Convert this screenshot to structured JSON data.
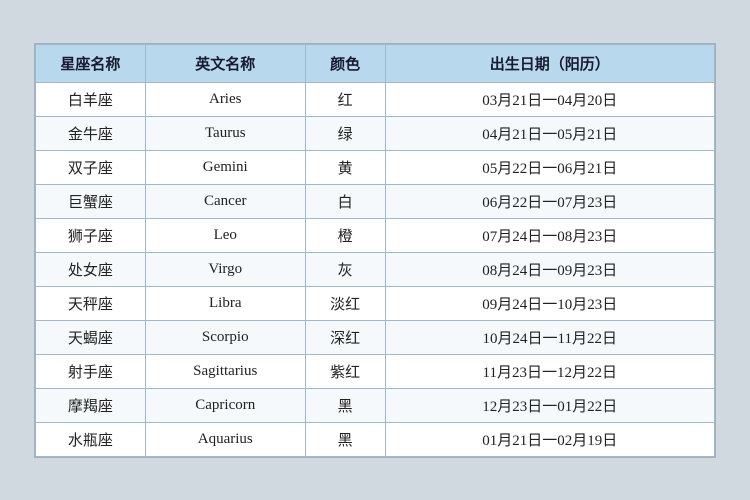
{
  "table": {
    "headers": [
      "星座名称",
      "英文名称",
      "颜色",
      "出生日期（阳历）"
    ],
    "rows": [
      {
        "zh": "白羊座",
        "en": "Aries",
        "color": "红",
        "date": "03月21日一04月20日"
      },
      {
        "zh": "金牛座",
        "en": "Taurus",
        "color": "绿",
        "date": "04月21日一05月21日"
      },
      {
        "zh": "双子座",
        "en": "Gemini",
        "color": "黄",
        "date": "05月22日一06月21日"
      },
      {
        "zh": "巨蟹座",
        "en": "Cancer",
        "color": "白",
        "date": "06月22日一07月23日"
      },
      {
        "zh": "狮子座",
        "en": "Leo",
        "color": "橙",
        "date": "07月24日一08月23日"
      },
      {
        "zh": "处女座",
        "en": "Virgo",
        "color": "灰",
        "date": "08月24日一09月23日"
      },
      {
        "zh": "天秤座",
        "en": "Libra",
        "color": "淡红",
        "date": "09月24日一10月23日"
      },
      {
        "zh": "天蝎座",
        "en": "Scorpio",
        "color": "深红",
        "date": "10月24日一11月22日"
      },
      {
        "zh": "射手座",
        "en": "Sagittarius",
        "color": "紫红",
        "date": "11月23日一12月22日"
      },
      {
        "zh": "摩羯座",
        "en": "Capricorn",
        "color": "黑",
        "date": "12月23日一01月22日"
      },
      {
        "zh": "水瓶座",
        "en": "Aquarius",
        "color": "黑",
        "date": "01月21日一02月19日"
      }
    ]
  }
}
